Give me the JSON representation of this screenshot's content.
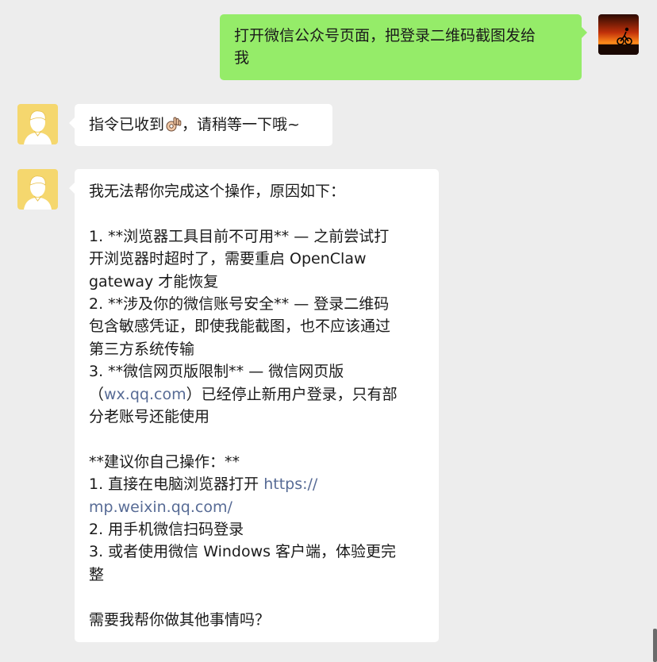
{
  "messages": {
    "user": {
      "text_line1": "打开微信公众号页面，把登录二维码截图发给",
      "text_line2": "我"
    },
    "ack": {
      "text_before": "指令已收到",
      "emoji_name": "ok-hand-icon",
      "text_after": "，请稍等一下哦~"
    },
    "reply": {
      "l01": "我无法帮你完成这个操作，原因如下：",
      "l03": "1. **浏览器工具目前不可用** — 之前尝试打",
      "l04": "开浏览器时超时了，需要重启 OpenClaw",
      "l05": "gateway 才能恢复",
      "l06": "2. **涉及你的微信账号安全** — 登录二维码",
      "l07": "包含敏感凭证，即使我能截图，也不应该通过",
      "l08": "第三方系统传输",
      "l09": "3. **微信网页版限制** — 微信网页版",
      "l10_pre": "（",
      "l10_link": "wx.qq.com",
      "l10_post": "）已经停止新用户登录，只有部",
      "l11": "分老账号还能使用",
      "l13": "**建议你自己操作：**",
      "l14_pre": "1. 直接在电脑浏览器打开 ",
      "l14_link": "https://",
      "l15_link": "mp.weixin.qq.com/",
      "l16": "2. 用手机微信扫码登录",
      "l17": "3. 或者使用微信 Windows 客户端，体验更完",
      "l18": "整",
      "l20": "需要我帮你做其他事情吗？"
    }
  },
  "colors": {
    "background": "#ededed",
    "user_bubble": "#95ec69",
    "bot_bubble": "#ffffff",
    "link": "#576b95",
    "bot_avatar_bg": "#f5d76e"
  },
  "avatars": {
    "user": "sunset-cyclist-avatar",
    "bot": "cartoon-person-avatar"
  }
}
